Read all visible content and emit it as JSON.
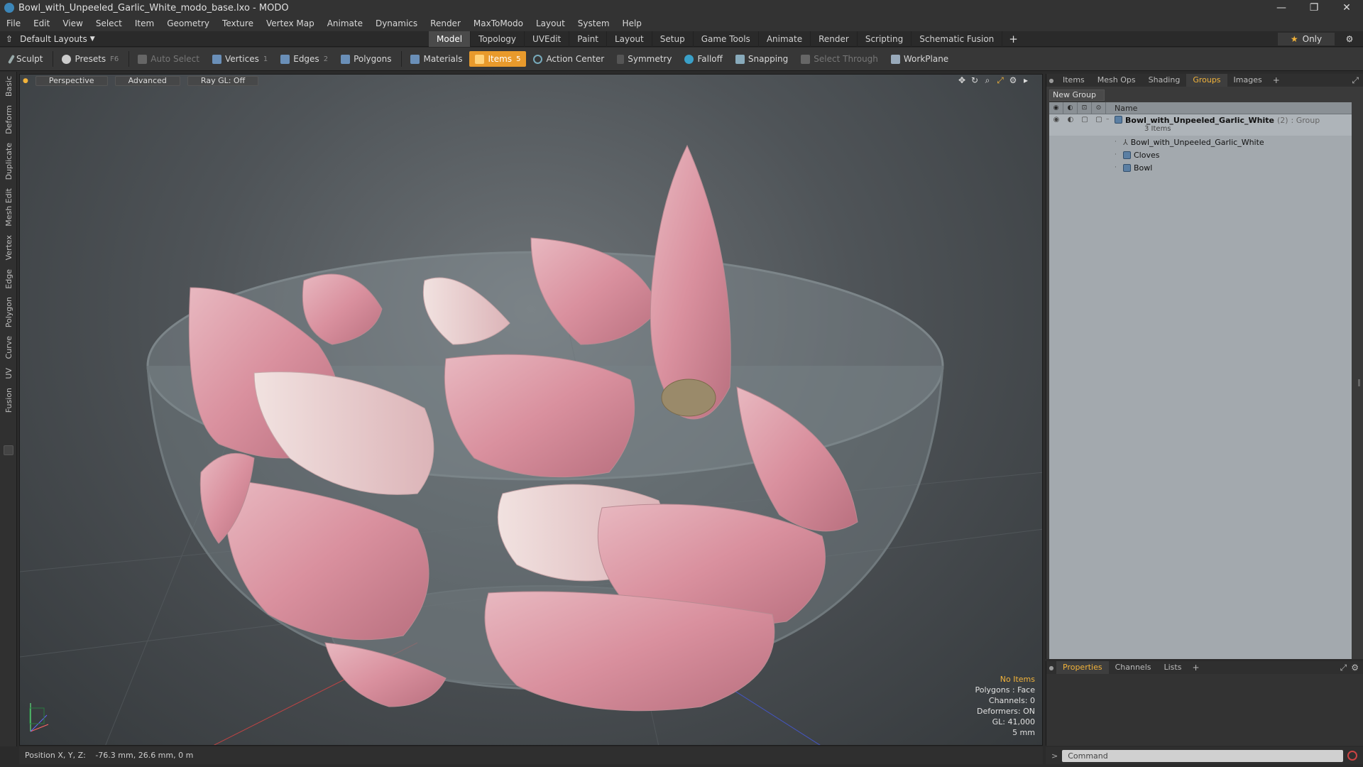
{
  "window": {
    "title": "Bowl_with_Unpeeled_Garlic_White_modo_base.lxo - MODO",
    "controls": [
      "—",
      "❐",
      "✕"
    ]
  },
  "menu": [
    "File",
    "Edit",
    "View",
    "Select",
    "Item",
    "Geometry",
    "Texture",
    "Vertex Map",
    "Animate",
    "Dynamics",
    "Render",
    "MaxToModo",
    "Layout",
    "System",
    "Help"
  ],
  "layout": {
    "preset_label": "Default Layouts",
    "tabs": [
      "Model",
      "Topology",
      "UVEdit",
      "Paint",
      "Layout",
      "Setup",
      "Game Tools",
      "Animate",
      "Render",
      "Scripting",
      "Schematic Fusion"
    ],
    "active_tab": "Model",
    "add_tab": "+",
    "only_label": "Only"
  },
  "toolbar": {
    "sculpt": "Sculpt",
    "presets": "Presets",
    "presets_key": "F6",
    "auto_select": "Auto Select",
    "vertices": "Vertices",
    "vertices_count": "1",
    "edges": "Edges",
    "edges_count": "2",
    "polygons": "Polygons",
    "materials": "Materials",
    "items": "Items",
    "items_count": "5",
    "action_center": "Action Center",
    "symmetry": "Symmetry",
    "falloff": "Falloff",
    "snapping": "Snapping",
    "select_through": "Select Through",
    "workplane": "WorkPlane"
  },
  "left_tabs": [
    "Basic",
    "Deform",
    "Duplicate",
    "Mesh Edit",
    "Vertex",
    "Edge",
    "Polygon",
    "Curve",
    "UV",
    "Fusion"
  ],
  "viewport": {
    "view_mode": "Perspective",
    "shading": "Advanced",
    "raygl": "Ray GL: Off",
    "info": {
      "selection": "No Items",
      "polygons": "Polygons : Face",
      "channels": "Channels: 0",
      "deformers": "Deformers: ON",
      "gl": "GL: 41,000",
      "scale": "5 mm"
    }
  },
  "status": {
    "label": "Position X, Y, Z:",
    "value": "-76.3 mm, 26.6 mm, 0 m"
  },
  "right_panel": {
    "tabs": [
      "Items",
      "Mesh Ops",
      "Shading",
      "Groups",
      "Images"
    ],
    "active_tab": "Groups",
    "new_group": "New Group",
    "column_name": "Name",
    "group": {
      "name": "Bowl_with_Unpeeled_Garlic_White",
      "count": "(2)",
      "type": ": Group",
      "sub": "3 Items"
    },
    "children": [
      "Bowl_with_Unpeeled_Garlic_White",
      "Cloves",
      "Bowl"
    ]
  },
  "properties_panel": {
    "tabs": [
      "Properties",
      "Channels",
      "Lists"
    ],
    "active_tab": "Properties"
  },
  "command": {
    "prompt": ">",
    "placeholder": "Command"
  },
  "colors": {
    "accent": "#f2b33a",
    "active_tool": "#e89a2c",
    "list_bg": "#a3a9ae"
  }
}
